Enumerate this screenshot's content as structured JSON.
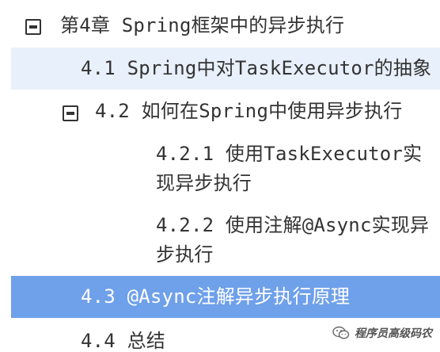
{
  "toc": {
    "chapter": {
      "label": "第4章 Spring框架中的异步执行",
      "expanded": true
    },
    "items": [
      {
        "label": "4.1 Spring中对TaskExecutor的抽象",
        "state": "hover"
      },
      {
        "label": "4.2 如何在Spring中使用异步执行",
        "expanded": true
      },
      {
        "label": "4.2.1 使用TaskExecutor实现异步执行"
      },
      {
        "label": "4.2.2 使用注解@Async实现异步执行"
      },
      {
        "label": "4.3 @Async注解异步执行原理",
        "state": "selected"
      },
      {
        "label": "4.4 总结"
      }
    ]
  },
  "watermark": {
    "text": "程序员高级码农",
    "icon": "wechat-icon"
  },
  "colors": {
    "hover_bg": "#e8f0fb",
    "selected_bg": "#6fa0ea",
    "text": "#333333"
  }
}
